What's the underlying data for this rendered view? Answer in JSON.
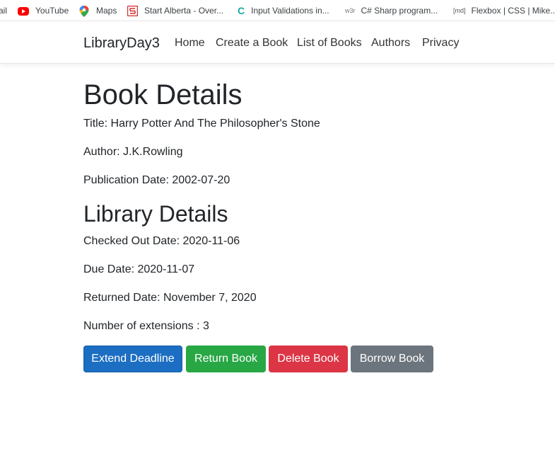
{
  "bookmarks": [
    {
      "label": "ail",
      "icon": "none"
    },
    {
      "label": "YouTube",
      "icon": "youtube-icon"
    },
    {
      "label": "Maps",
      "icon": "maps-pin-icon"
    },
    {
      "label": "Start Alberta - Over...",
      "icon": "start-alberta-icon"
    },
    {
      "label": "Input Validations in...",
      "icon": "c-letter-icon",
      "icon_text": "C"
    },
    {
      "label": "C# Sharp program...",
      "icon": "w3r-icon",
      "icon_text": "w3r"
    },
    {
      "label": "Flexbox | CSS | Mike...",
      "icon": "md-icon",
      "icon_text": "[md]"
    }
  ],
  "navbar": {
    "brand": "LibraryDay3",
    "links": [
      "Home",
      "Create a Book",
      "List of Books",
      "Authors",
      "Privacy"
    ]
  },
  "book": {
    "heading": "Book Details",
    "title": "Title: Harry Potter And The Philosopher's Stone",
    "author": "Author: J.K.Rowling",
    "publication_date": "Publication Date: 2002-07-20"
  },
  "library": {
    "heading": "Library Details",
    "checked_out": "Checked Out Date: 2020-11-06",
    "due": "Due Date: 2020-11-07",
    "returned": "Returned Date: November 7, 2020",
    "extensions": "Number of extensions : 3"
  },
  "actions": {
    "extend": "Extend Deadline",
    "return": "Return Book",
    "delete": "Delete Book",
    "borrow": "Borrow Book"
  },
  "colors": {
    "primary": "#1b6ec2",
    "success": "#28a745",
    "danger": "#dc3545",
    "secondary": "#6c757d"
  }
}
